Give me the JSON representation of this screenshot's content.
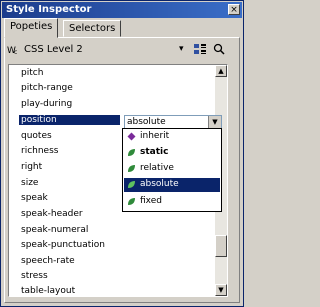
{
  "window": {
    "title": "Style Inspector",
    "close": "×"
  },
  "tabs": [
    {
      "label": "Popeties"
    },
    {
      "label": "Selectors"
    }
  ],
  "toolbar": {
    "profile": "CSS Level 2",
    "profile_icon": "wc-icon",
    "menu_arrow": "▾",
    "view_icon": "grid-icon",
    "search_icon": "search-icon"
  },
  "properties": [
    {
      "name": "pitch",
      "value": ""
    },
    {
      "name": "pitch-range",
      "value": ""
    },
    {
      "name": "play-during",
      "value": ""
    },
    {
      "name": "position",
      "value": ""
    },
    {
      "name": "quotes",
      "value": ""
    },
    {
      "name": "richness",
      "value": ""
    },
    {
      "name": "right",
      "value": ""
    },
    {
      "name": "size",
      "value": ""
    },
    {
      "name": "speak",
      "value": ""
    },
    {
      "name": "speak-header",
      "value": ""
    },
    {
      "name": "speak-numeral",
      "value": ""
    },
    {
      "name": "speak-punctuation",
      "value": ""
    },
    {
      "name": "speech-rate",
      "value": ""
    },
    {
      "name": "stress",
      "value": ""
    },
    {
      "name": "table-layout",
      "value": ""
    }
  ],
  "editor": {
    "value": "absolute",
    "options": [
      {
        "label": "inherit",
        "icon": "purple-diamond",
        "highlighted": false,
        "bold": false
      },
      {
        "label": "static",
        "icon": "green-leaf",
        "highlighted": false,
        "bold": true
      },
      {
        "label": "relative",
        "icon": "green-leaf",
        "highlighted": false,
        "bold": false
      },
      {
        "label": "absolute",
        "icon": "green-leaf",
        "highlighted": true,
        "bold": false
      },
      {
        "label": "fixed",
        "icon": "green-leaf",
        "highlighted": false,
        "bold": false
      }
    ]
  },
  "colors": {
    "title_bar": "#1c3c8c",
    "selection": "#0a246a",
    "chrome": "#d4d0c8"
  }
}
